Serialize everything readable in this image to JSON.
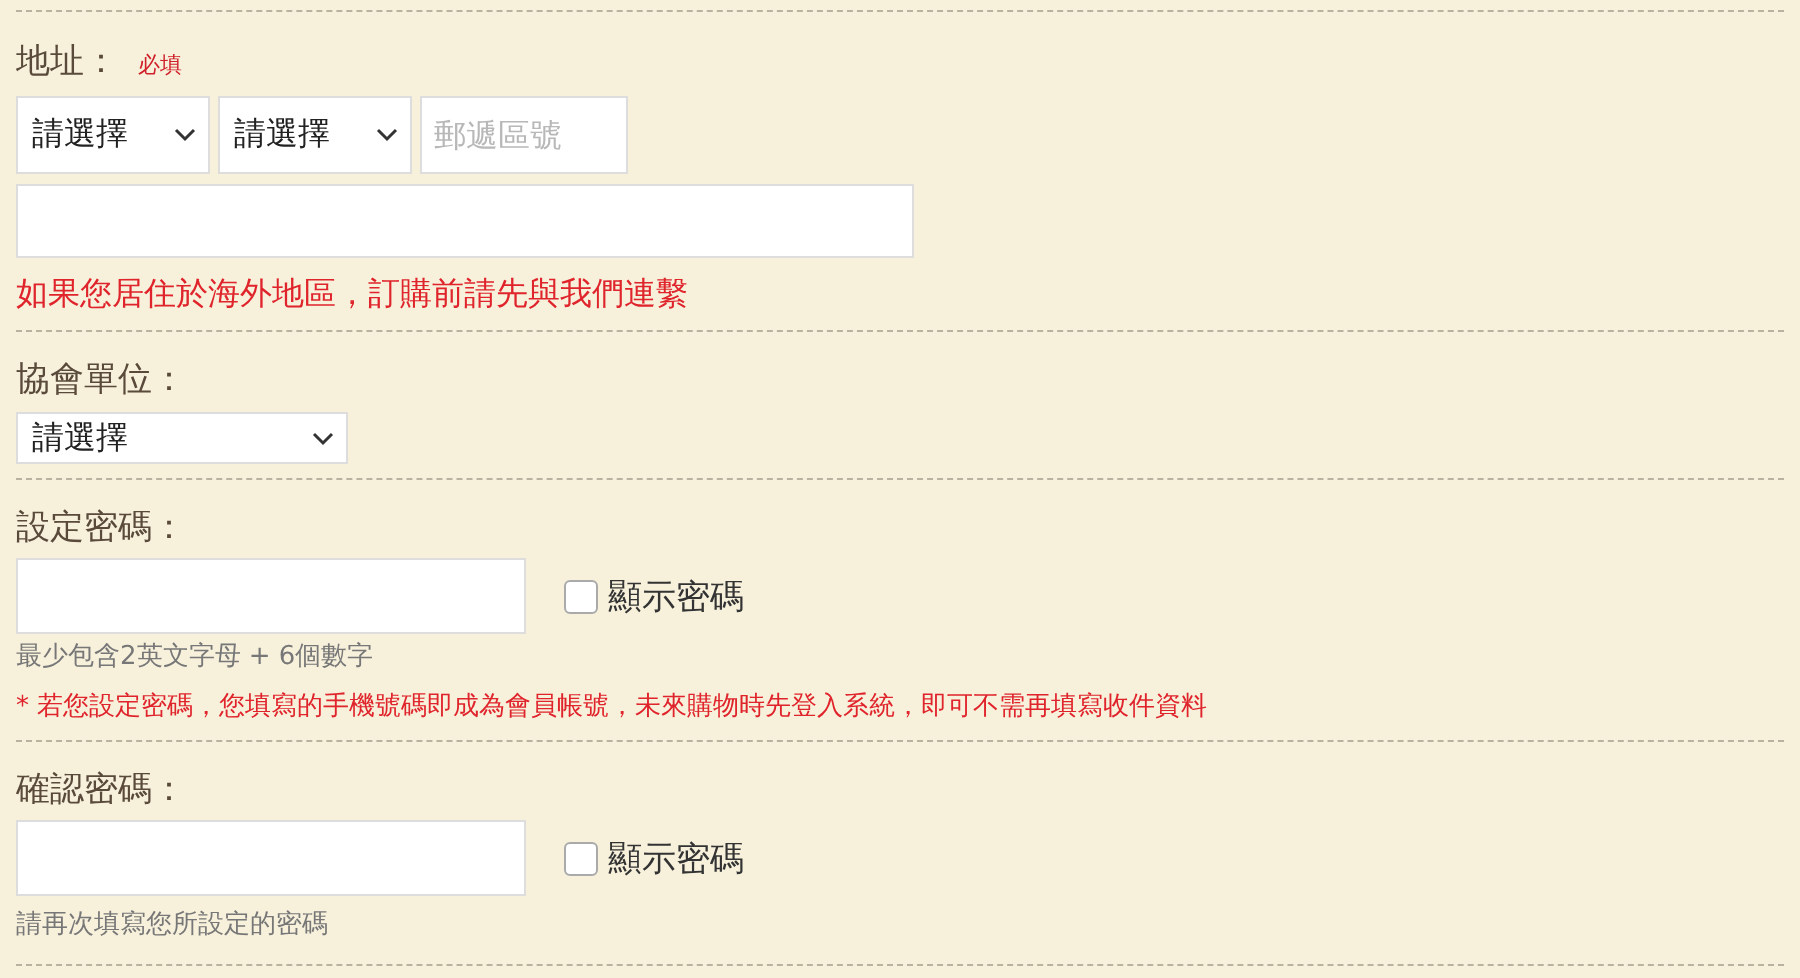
{
  "address": {
    "label": "地址：",
    "required": "必填",
    "selects": [
      {
        "value": "請選擇"
      },
      {
        "value": "請選擇"
      }
    ],
    "postal": {
      "placeholder": "郵遞區號"
    },
    "notice": "如果您居住於海外地區，訂購前請先與我們連繫"
  },
  "association": {
    "label": "協會單位：",
    "select": {
      "value": "請選擇"
    }
  },
  "password": {
    "label": "設定密碼：",
    "show": {
      "label": "顯示密碼",
      "checked": false
    },
    "hint": "最少包含2英文字母 + 6個數字",
    "notice": "* 若您設定密碼，您填寫的手機號碼即成為會員帳號，未來購物時先登入系統，即可不需再填寫收件資料"
  },
  "confirm": {
    "label": "確認密碼：",
    "show": {
      "label": "顯示密碼",
      "checked": false
    },
    "hint": "請再次填寫您所設定的密碼"
  }
}
